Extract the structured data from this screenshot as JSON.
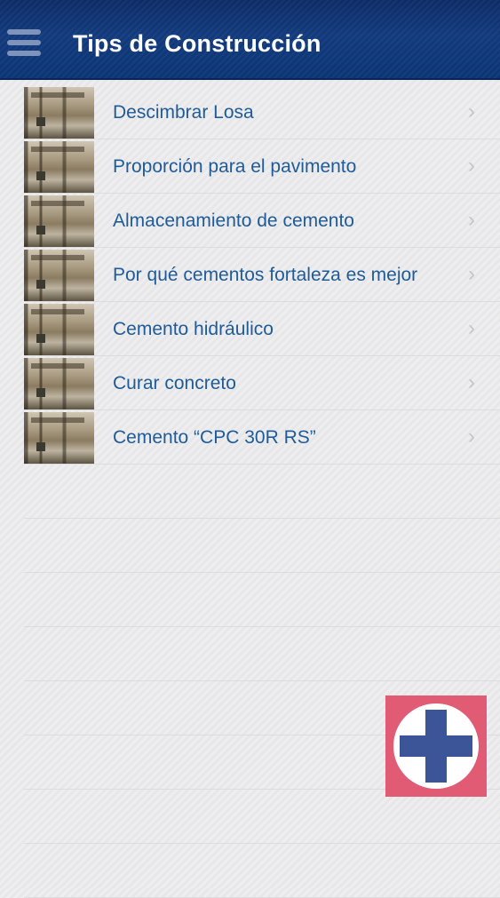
{
  "navbar": {
    "title": "Tips de Construcción",
    "menu_icon": "hamburger-menu-icon"
  },
  "items": [
    {
      "label": "Descimbrar Losa"
    },
    {
      "label": "Proporción para el pavimento"
    },
    {
      "label": "Almacenamiento de cemento"
    },
    {
      "label": "Por qué cementos fortaleza es mejor"
    },
    {
      "label": "Cemento hidráulico"
    },
    {
      "label": "Curar concreto"
    },
    {
      "label": "Cemento “CPC 30R RS”"
    }
  ],
  "fab": {
    "icon": "medical-cross-icon",
    "background": "#e25b75",
    "cross_color": "#3b5598"
  },
  "colors": {
    "navbar": "#123a7c",
    "item_text": "#1f5b98"
  }
}
